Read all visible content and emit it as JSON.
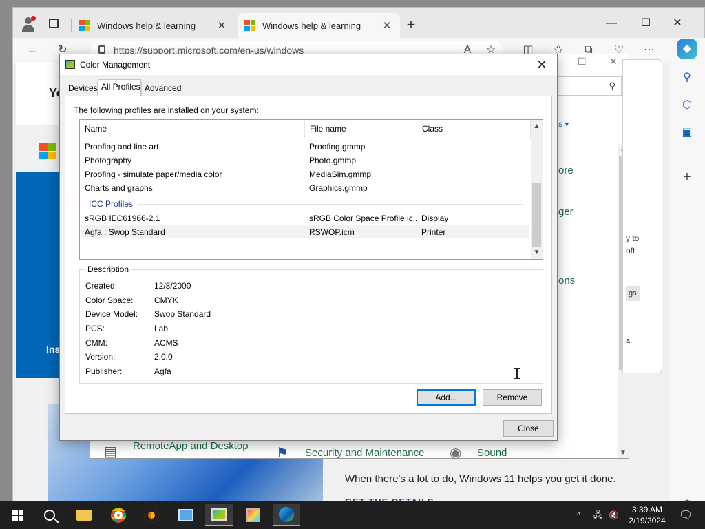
{
  "browser": {
    "tabs": [
      {
        "title": "Windows help & learning"
      },
      {
        "title": "Windows help & learning"
      }
    ],
    "url": "https://support.microsoft.com/en-us/windows"
  },
  "page": {
    "partial_heading": "Yo",
    "partial_blue": "Ins",
    "tagline": "When there's a lot to do, Windows 11 helps you get it done.",
    "link": "GET THE DETAILS"
  },
  "control_panel": {
    "right_links": [
      "ore",
      "ger",
      "ons"
    ],
    "items": [
      "RemoteApp and Desktop",
      "Security and Maintenance",
      "Sound"
    ],
    "side_text": [
      "y to",
      "oft",
      "gs",
      "a."
    ]
  },
  "dialog": {
    "title": "Color Management",
    "tabs": [
      "Devices",
      "All Profiles",
      "Advanced"
    ],
    "installed_label": "The following profiles are installed on your system:",
    "columns": [
      "Name",
      "File name",
      "Class"
    ],
    "rows": [
      {
        "name": "Proofing and line art",
        "file": "Proofing.gmmp",
        "class": ""
      },
      {
        "name": "Photography",
        "file": "Photo.gmmp",
        "class": ""
      },
      {
        "name": "Proofing - simulate paper/media color",
        "file": "MediaSim.gmmp",
        "class": ""
      },
      {
        "name": "Charts and graphs",
        "file": "Graphics.gmmp",
        "class": ""
      }
    ],
    "icc_group": "ICC Profiles",
    "icc_rows": [
      {
        "name": "sRGB IEC61966-2.1",
        "file": "sRGB Color Space Profile.ic...",
        "class": "Display"
      },
      {
        "name": "Agfa : Swop Standard",
        "file": "RSWOP.icm",
        "class": "Printer"
      }
    ],
    "description": {
      "legend": "Description",
      "fields": [
        {
          "label": "Created:",
          "value": "12/8/2000"
        },
        {
          "label": "Color Space:",
          "value": "CMYK"
        },
        {
          "label": "Device Model:",
          "value": "Swop Standard"
        },
        {
          "label": "PCS:",
          "value": "Lab"
        },
        {
          "label": "CMM:",
          "value": "ACMS"
        },
        {
          "label": "Version:",
          "value": "2.0.0"
        },
        {
          "label": "Publisher:",
          "value": "Agfa"
        }
      ]
    },
    "buttons": {
      "add": "Add...",
      "remove": "Remove",
      "close": "Close"
    }
  },
  "taskbar": {
    "time": "3:39 AM",
    "date": "2/19/2024"
  }
}
